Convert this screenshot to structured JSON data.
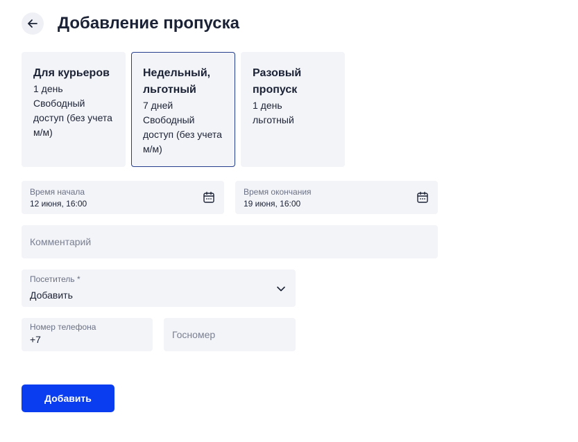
{
  "header": {
    "title": "Добавление пропуска"
  },
  "cards": [
    {
      "title": "Для курьеров",
      "lines": [
        "1 день",
        "Свободный",
        "доступ (без учета",
        "м/м)"
      ]
    },
    {
      "title_lines": [
        "Недельный,",
        "льготный"
      ],
      "lines": [
        "7 дней",
        "Свободный",
        "доступ (без учета",
        "м/м)"
      ],
      "selected": true
    },
    {
      "title_lines": [
        "Разовый",
        "пропуск"
      ],
      "lines": [
        "1 день",
        "льготный"
      ]
    }
  ],
  "start_time": {
    "label": "Время начала",
    "value": "12 июня, 16:00"
  },
  "end_time": {
    "label": "Время окончания",
    "value": "19 июня, 16:00"
  },
  "comment": {
    "placeholder": "Комментарий"
  },
  "visitor": {
    "label": "Посетитель *",
    "value": "Добавить"
  },
  "phone": {
    "label": "Номер телефона",
    "value": "+7"
  },
  "plate": {
    "placeholder": "Госномер"
  },
  "submit": {
    "label": "Добавить"
  },
  "colors": {
    "accent": "#0a3cf0",
    "selected_border": "#233d8c",
    "field_bg": "#f3f4f8"
  }
}
